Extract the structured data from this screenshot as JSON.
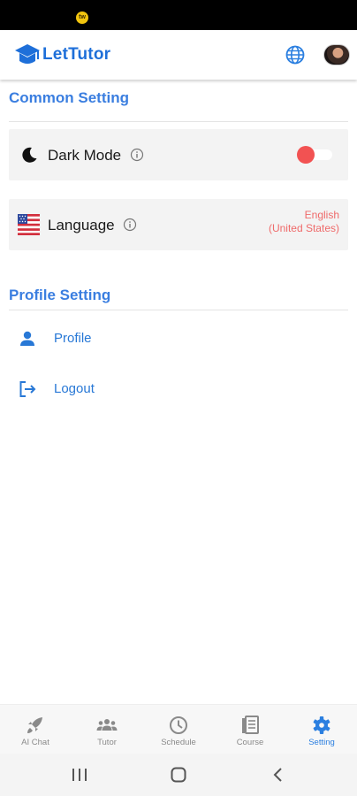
{
  "status_bar": {
    "notification_badge": "tw"
  },
  "header": {
    "app_name": "LetTutor",
    "brand_color": "#1e6fd9"
  },
  "common_setting": {
    "title": "Common Setting",
    "dark_mode": {
      "label": "Dark Mode",
      "enabled": true
    },
    "language": {
      "label": "Language",
      "value_line1": "English",
      "value_line2": "(United States)"
    }
  },
  "profile_setting": {
    "title": "Profile Setting",
    "items": [
      {
        "label": "Profile",
        "icon": "person-icon"
      },
      {
        "label": "Logout",
        "icon": "logout-icon"
      }
    ]
  },
  "bottom_nav": {
    "items": [
      {
        "label": "AI Chat",
        "icon": "rocket-icon",
        "active": false
      },
      {
        "label": "Tutor",
        "icon": "group-icon",
        "active": false
      },
      {
        "label": "Schedule",
        "icon": "clock-icon",
        "active": false
      },
      {
        "label": "Course",
        "icon": "book-icon",
        "active": false
      },
      {
        "label": "Setting",
        "icon": "gear-icon",
        "active": true
      }
    ]
  },
  "colors": {
    "accent": "#2b7fe0",
    "toggle_thumb": "#f25252",
    "language_value": "#ef6a6a"
  }
}
